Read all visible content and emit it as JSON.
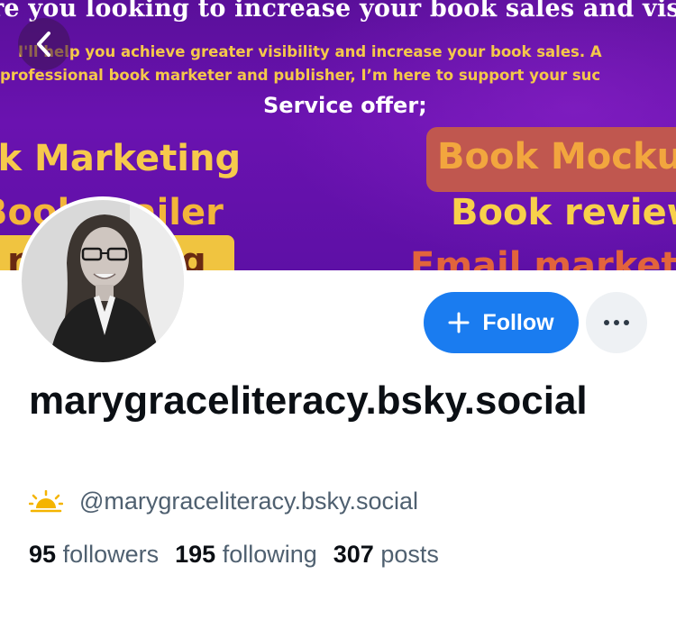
{
  "banner": {
    "headline": "re you looking to increase your book sales and visibilit",
    "line1": "I'll help you achieve greater visibility and increase your book sales. A",
    "line2": "professional book marketer and publisher, I’m here to support your suc",
    "service_heading": "Service offer;",
    "services_left": [
      "ok Marketing",
      "Book Trailer",
      "ro Editing"
    ],
    "services_right": [
      "Book Mocku",
      "Book review",
      "Email marketi"
    ]
  },
  "actions": {
    "follow_label": "Follow",
    "more_label": "more options"
  },
  "profile": {
    "display_name": "marygraceliteracy.bsky.social",
    "handle": "@marygraceliteracy.bsky.social",
    "handle_icon": "sunrise-icon"
  },
  "stats": {
    "followers_count": "95",
    "followers_label": "followers",
    "following_count": "195",
    "following_label": "following",
    "posts_count": "307",
    "posts_label": "posts"
  },
  "colors": {
    "follow_button": "#1a7cf0",
    "banner_purple": "#6a12b0",
    "banner_gold": "#f6c94c",
    "secondary_text": "#4f6070"
  },
  "icons": {
    "back": "chevron-left-icon",
    "follow": "plus-icon",
    "more": "ellipsis-icon"
  }
}
